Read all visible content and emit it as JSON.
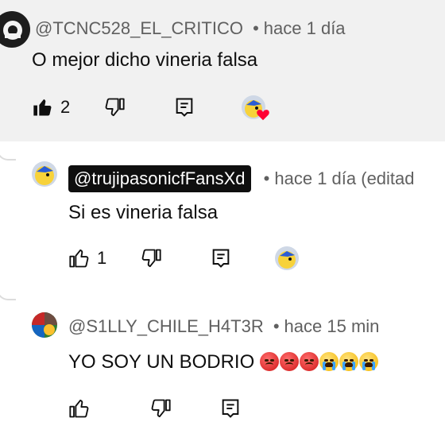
{
  "comments": [
    {
      "author": "@TCNC528_EL_CRITICO",
      "separator": "•",
      "time": "hace 1 día",
      "text": "O mejor dicho vineria falsa",
      "like_count": "2",
      "avatar_icon": "dark-avatar",
      "liked": true,
      "hearted": true
    },
    {
      "author": "@trujipasonicfFansXd",
      "separator": "•",
      "time": "hace 1 día (editad",
      "text": "Si es vineria falsa",
      "like_count": "1",
      "avatar_icon": "bird-avatar",
      "liked": false,
      "hearted": false
    },
    {
      "author": "@S1LLY_CHILE_H4T3R",
      "separator": "•",
      "time": "hace 15 min",
      "text": "YO SOY UN BODRIO",
      "like_count": "",
      "avatar_icon": "colorful-avatar",
      "emojis": [
        "angry-face",
        "angry-face",
        "angry-face",
        "crying-face",
        "crying-face",
        "crying-face"
      ]
    }
  ],
  "colors": {
    "highlight_bg": "#f1f1f1",
    "meta_text": "#606060",
    "heart": "#ff0033"
  }
}
